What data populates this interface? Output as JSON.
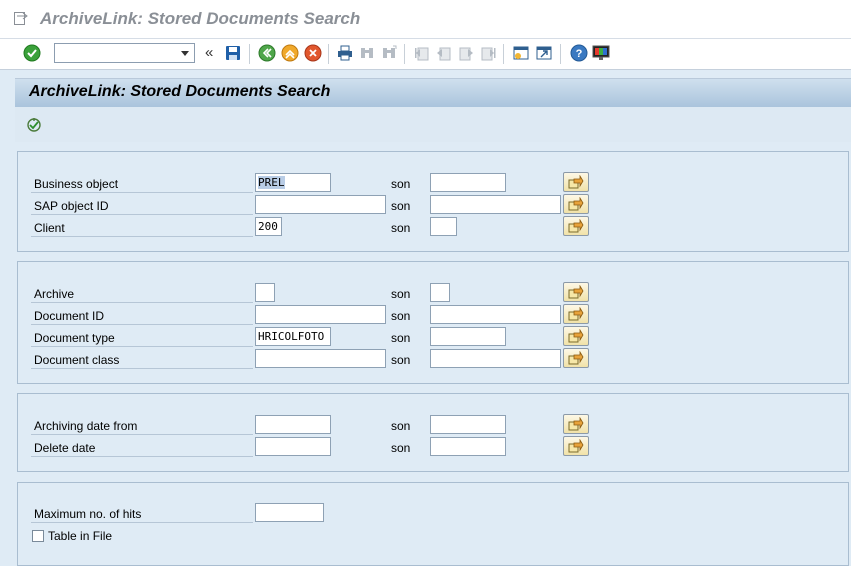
{
  "window": {
    "title": "ArchiveLink: Stored Documents Search"
  },
  "toolbar": {
    "command_field_value": "",
    "icons": [
      "enter-icon",
      "command-field",
      "back-nav-icon",
      "save-icon",
      "back-icon",
      "exit-icon",
      "cancel-icon",
      "print-icon",
      "find-icon",
      "find-next-icon",
      "first-page-icon",
      "previous-page-icon",
      "next-page-icon",
      "last-page-icon",
      "create-session-icon",
      "shortcut-icon",
      "help-icon",
      "customize-layout-icon"
    ]
  },
  "screen": {
    "title": "ArchiveLink: Stored Documents Search",
    "execute_icon": "execute-icon"
  },
  "son_label": "son",
  "groups": [
    {
      "rows": [
        {
          "label": "Business object",
          "from": "PREL",
          "to": ""
        },
        {
          "label": "SAP object ID",
          "from": "",
          "to": ""
        },
        {
          "label": "Client",
          "from": "200",
          "to": ""
        }
      ]
    },
    {
      "rows": [
        {
          "label": "Archive",
          "from": "",
          "to": ""
        },
        {
          "label": "Document ID",
          "from": "",
          "to": ""
        },
        {
          "label": "Document type",
          "from": "HRICOLFOTO",
          "to": ""
        },
        {
          "label": "Document class",
          "from": "",
          "to": ""
        }
      ]
    },
    {
      "rows": [
        {
          "label": "Archiving date from",
          "from": "",
          "to": ""
        },
        {
          "label": "Delete date",
          "from": "",
          "to": ""
        }
      ]
    },
    {
      "rows": [
        {
          "label": "Maximum no. of hits",
          "from": ""
        }
      ],
      "checkbox": {
        "label": "Table in File",
        "checked": false
      }
    }
  ]
}
